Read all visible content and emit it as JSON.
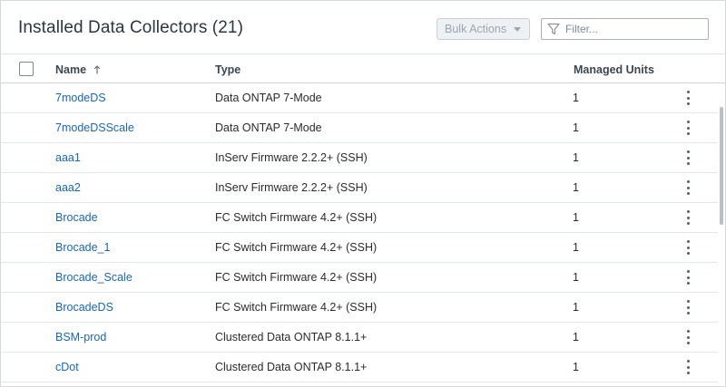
{
  "header": {
    "title": "Installed Data Collectors (21)",
    "bulk_actions_label": "Bulk Actions",
    "filter_placeholder": "Filter..."
  },
  "table": {
    "columns": {
      "name": "Name",
      "type": "Type",
      "managed_units": "Managed Units"
    },
    "sort": {
      "column": "name",
      "direction": "ascending"
    },
    "rows": [
      {
        "name": "7modeDS",
        "type": "Data ONTAP 7-Mode",
        "managed_units": "1"
      },
      {
        "name": "7modeDSScale",
        "type": "Data ONTAP 7-Mode",
        "managed_units": "1"
      },
      {
        "name": "aaa1",
        "type": "InServ Firmware 2.2.2+ (SSH)",
        "managed_units": "1"
      },
      {
        "name": "aaa2",
        "type": "InServ Firmware 2.2.2+ (SSH)",
        "managed_units": "1"
      },
      {
        "name": "Brocade",
        "type": "FC Switch Firmware 4.2+ (SSH)",
        "managed_units": "1"
      },
      {
        "name": "Brocade_1",
        "type": "FC Switch Firmware 4.2+ (SSH)",
        "managed_units": "1"
      },
      {
        "name": "Brocade_Scale",
        "type": "FC Switch Firmware 4.2+ (SSH)",
        "managed_units": "1"
      },
      {
        "name": "BrocadeDS",
        "type": "FC Switch Firmware 4.2+ (SSH)",
        "managed_units": "1"
      },
      {
        "name": "BSM-prod",
        "type": "Clustered Data ONTAP 8.1.1+",
        "managed_units": "1"
      },
      {
        "name": "cDot",
        "type": "Clustered Data ONTAP 8.1.1+",
        "managed_units": "1"
      }
    ]
  },
  "icons": {
    "filter": "filter-funnel-icon",
    "sort": "arrow-up-icon",
    "row_menu": "kebab-menu-icon",
    "bulk_caret": "caret-down-icon"
  },
  "colors": {
    "link": "#1a66b0",
    "title": "#2b3740",
    "button_disabled_bg": "#eef1f4",
    "button_disabled_text": "#9aa6b1"
  }
}
